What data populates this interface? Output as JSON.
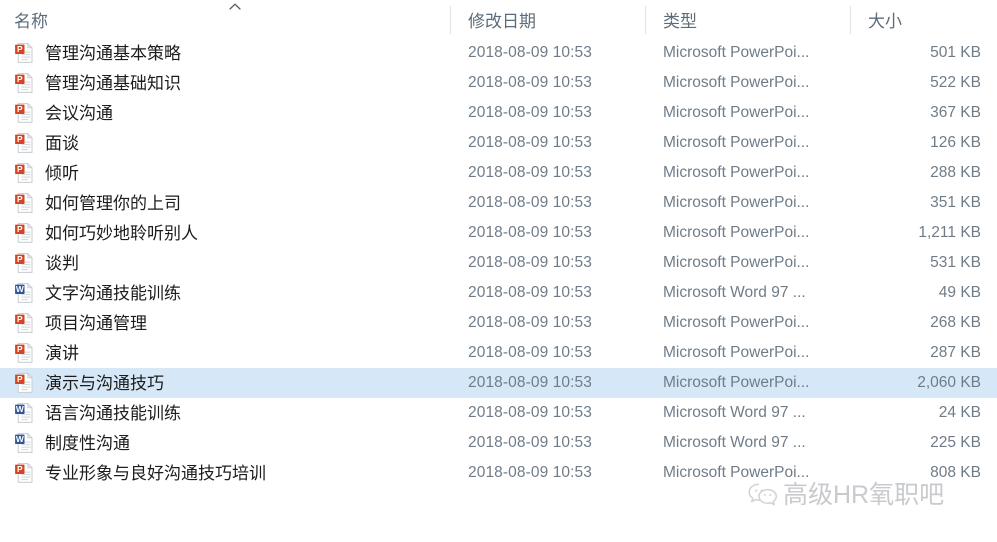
{
  "window": {
    "view": "details-list"
  },
  "columns": {
    "name": "名称",
    "date_modified": "修改日期",
    "type": "类型",
    "size": "大小",
    "sort_indicator": "^",
    "sorted_by": "name",
    "sort_direction": "ascending"
  },
  "colors": {
    "selection": "#d6e8f7",
    "header_text": "#5d6c7b",
    "secondary_text": "#6f7c88",
    "primary_text": "#1c1c1c",
    "powerpoint_icon": "#d24625",
    "word_icon": "#2b579a",
    "divider": "#dfe3e6",
    "watermark_text": "#b9bcc0"
  },
  "files": [
    {
      "name": "管理沟通基本策略",
      "date": "2018-08-09 10:53",
      "type": "Microsoft PowerPoi...",
      "size": "501 KB",
      "icon": "powerpoint-file-icon",
      "selected": false
    },
    {
      "name": "管理沟通基础知识",
      "date": "2018-08-09 10:53",
      "type": "Microsoft PowerPoi...",
      "size": "522 KB",
      "icon": "powerpoint-file-icon",
      "selected": false
    },
    {
      "name": "会议沟通",
      "date": "2018-08-09 10:53",
      "type": "Microsoft PowerPoi...",
      "size": "367 KB",
      "icon": "powerpoint-file-icon",
      "selected": false
    },
    {
      "name": "面谈",
      "date": "2018-08-09 10:53",
      "type": "Microsoft PowerPoi...",
      "size": "126 KB",
      "icon": "powerpoint-file-icon",
      "selected": false
    },
    {
      "name": "倾听",
      "date": "2018-08-09 10:53",
      "type": "Microsoft PowerPoi...",
      "size": "288 KB",
      "icon": "powerpoint-file-icon",
      "selected": false
    },
    {
      "name": "如何管理你的上司",
      "date": "2018-08-09 10:53",
      "type": "Microsoft PowerPoi...",
      "size": "351 KB",
      "icon": "powerpoint-file-icon",
      "selected": false
    },
    {
      "name": "如何巧妙地聆听别人",
      "date": "2018-08-09 10:53",
      "type": "Microsoft PowerPoi...",
      "size": "1,211 KB",
      "icon": "powerpoint-file-icon",
      "selected": false
    },
    {
      "name": "谈判",
      "date": "2018-08-09 10:53",
      "type": "Microsoft PowerPoi...",
      "size": "531 KB",
      "icon": "powerpoint-file-icon",
      "selected": false
    },
    {
      "name": "文字沟通技能训练",
      "date": "2018-08-09 10:53",
      "type": "Microsoft Word 97 ...",
      "size": "49 KB",
      "icon": "word-file-icon",
      "selected": false
    },
    {
      "name": "项目沟通管理",
      "date": "2018-08-09 10:53",
      "type": "Microsoft PowerPoi...",
      "size": "268 KB",
      "icon": "powerpoint-file-icon",
      "selected": false
    },
    {
      "name": "演讲",
      "date": "2018-08-09 10:53",
      "type": "Microsoft PowerPoi...",
      "size": "287 KB",
      "icon": "powerpoint-file-icon",
      "selected": false
    },
    {
      "name": "演示与沟通技巧",
      "date": "2018-08-09 10:53",
      "type": "Microsoft PowerPoi...",
      "size": "2,060 KB",
      "icon": "powerpoint-file-icon",
      "selected": true
    },
    {
      "name": "语言沟通技能训练",
      "date": "2018-08-09 10:53",
      "type": "Microsoft Word 97 ...",
      "size": "24 KB",
      "icon": "word-file-icon",
      "selected": false
    },
    {
      "name": "制度性沟通",
      "date": "2018-08-09 10:53",
      "type": "Microsoft Word 97 ...",
      "size": "225 KB",
      "icon": "word-file-icon",
      "selected": false
    },
    {
      "name": "专业形象与良好沟通技巧培训",
      "date": "2018-08-09 10:53",
      "type": "Microsoft PowerPoi...",
      "size": "808 KB",
      "icon": "powerpoint-file-icon",
      "selected": false
    }
  ],
  "watermark": {
    "text": "高级HR氧职吧",
    "logo": "wechat-logo-icon"
  }
}
